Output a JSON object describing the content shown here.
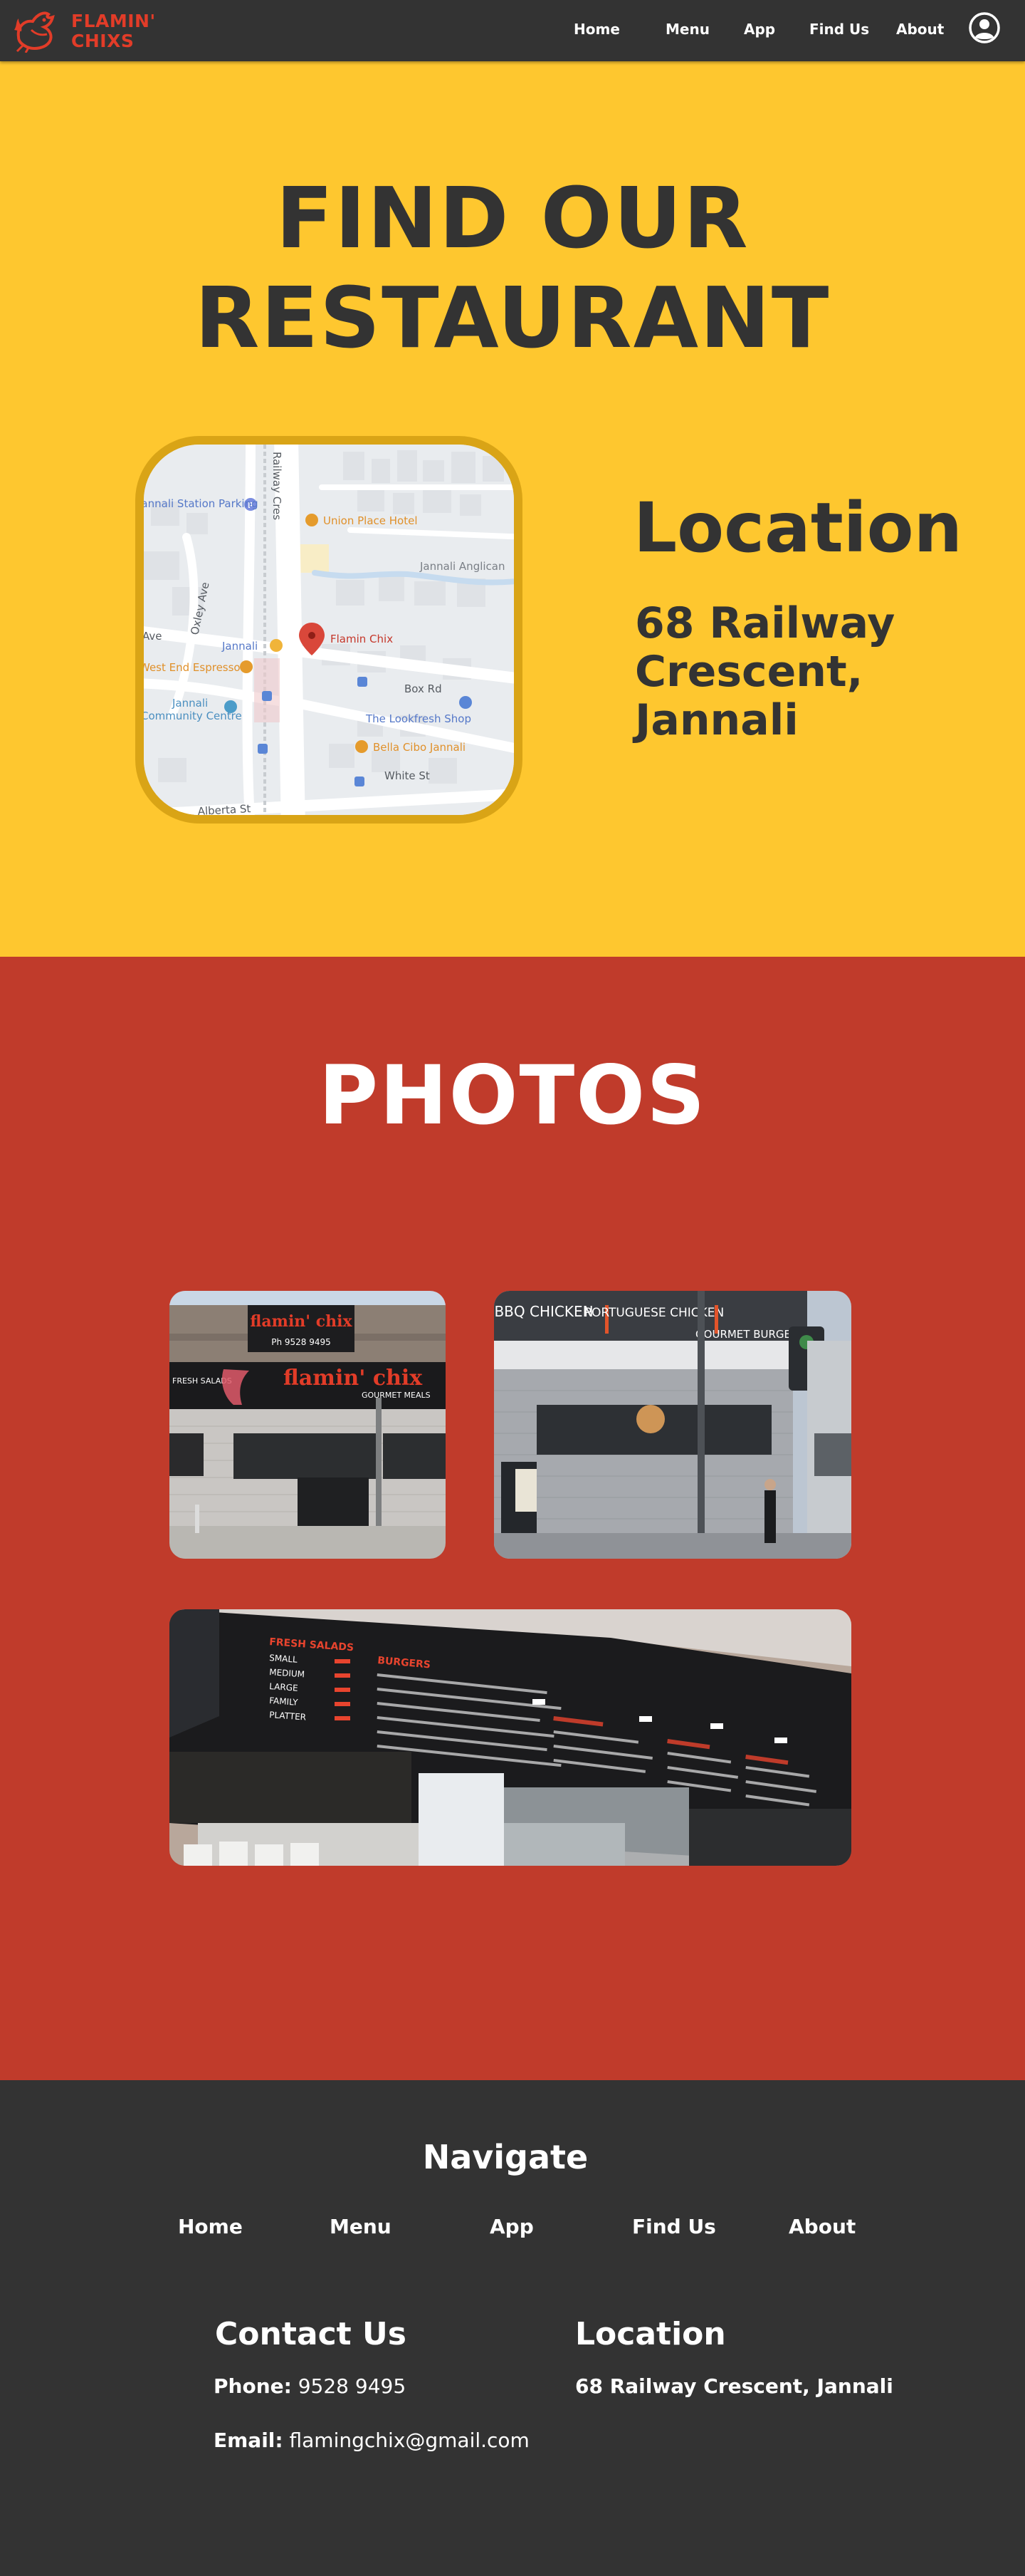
{
  "brand": {
    "line1": "FLAMIN'",
    "line2": "CHIXS",
    "accent_color": "#e23c28"
  },
  "nav": {
    "items": [
      {
        "label": "Home"
      },
      {
        "label": "Menu"
      },
      {
        "label": "App"
      },
      {
        "label": "Find Us"
      },
      {
        "label": "About"
      }
    ],
    "account_icon": "account-circle-icon"
  },
  "find": {
    "title_line1": "FIND OUR",
    "title_line2": "RESTAURANT",
    "background_color": "#fec72f",
    "map": {
      "labels": {
        "station_parking": "Jannali Station Parking",
        "union_hotel": "Union Place Hotel",
        "jannali_anglican": "Jannali Anglican",
        "flamin_chix": "Flamin Chix",
        "jannali": "Jannali",
        "west_end": "West End Espresso",
        "community_centre_1": "Jannali",
        "community_centre_2": "Community Centre",
        "box_rd": "Box Rd",
        "lookfresh": "The Lookfresh Shop",
        "bella_cibo": "Bella Cibo Jannali",
        "white_st": "White St",
        "alberta_st": "Alberta St",
        "railway_cres": "Railway Cres",
        "oxley_ave": "Oxley Ave",
        "ave": "Ave"
      }
    },
    "location_heading": "Location",
    "address": "68 Railway Crescent, Jannali"
  },
  "photos": {
    "title": "PHOTOS",
    "background_color": "#c03b2b",
    "photo1": {
      "sign_text": "flamin' chix",
      "phone": "Ph 9528 9495",
      "awning_left": "FRESH SALADS",
      "awning_brand": "flamin' chix",
      "awning_right": "GOURMET MEALS"
    },
    "photo2": {
      "sign_bbq": "BBQ CHICKEN",
      "sign_portuguese": "PORTUGUESE CHICKEN",
      "sign_gourmet": "GOURMET BURGERS"
    },
    "photo3": {
      "menu_heading_left": "FRESH SALADS",
      "menu_items_left": [
        "SMALL",
        "MEDIUM",
        "LARGE",
        "FAMILY",
        "PLATTER"
      ],
      "menu_heading_mid": "BURGERS"
    }
  },
  "footer": {
    "navigate_title": "Navigate",
    "links": [
      {
        "label": "Home"
      },
      {
        "label": "Menu"
      },
      {
        "label": "App"
      },
      {
        "label": "Find Us"
      },
      {
        "label": "About"
      }
    ],
    "contact_title": "Contact Us",
    "phone_label": "Phone:",
    "phone_value": "9528 9495",
    "email_label": "Email:",
    "email_value": "flamingchix@gmail.com",
    "location_title": "Location",
    "location_value": "68 Railway Crescent, Jannali"
  }
}
